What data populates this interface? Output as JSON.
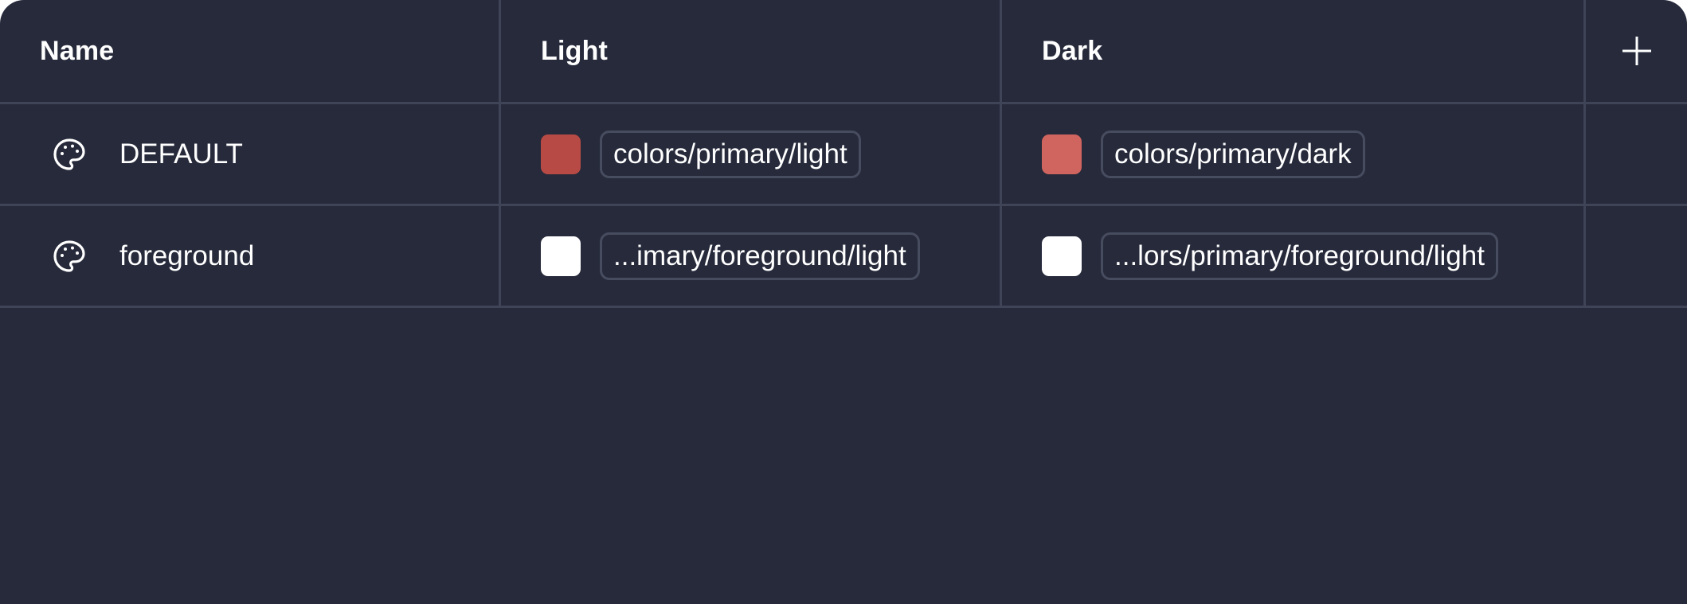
{
  "table": {
    "columns": [
      "Name",
      "Light",
      "Dark"
    ],
    "rows": [
      {
        "icon": "palette-icon",
        "name": "DEFAULT",
        "light": {
          "color": "#b84a45",
          "token": "colors/primary/light"
        },
        "dark": {
          "color": "#d0645f",
          "token": "colors/primary/dark"
        }
      },
      {
        "icon": "palette-icon",
        "name": "foreground",
        "light": {
          "color": "#ffffff",
          "token": "...imary/foreground/light"
        },
        "dark": {
          "color": "#ffffff",
          "token": "...lors/primary/foreground/light"
        }
      }
    ],
    "add_icon": "plus-icon"
  },
  "colors": {
    "background": "#262a3b",
    "divider": "#3f4456",
    "token_border": "#474c5e",
    "text": "#ffffff"
  }
}
